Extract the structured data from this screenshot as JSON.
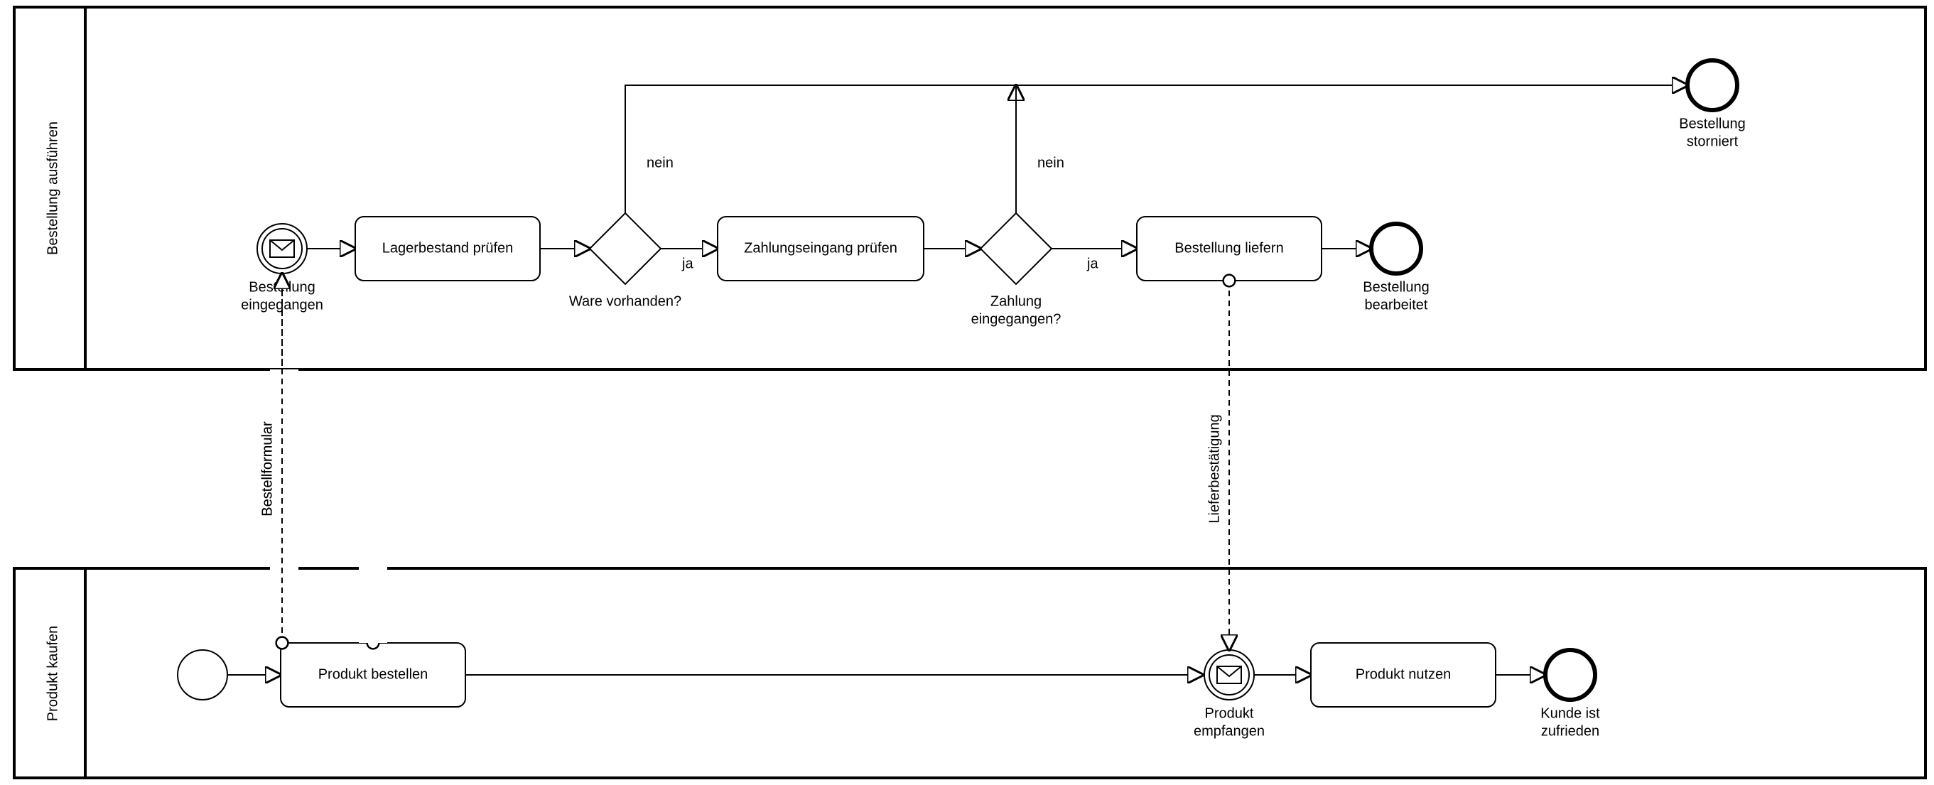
{
  "pools": {
    "top": {
      "name": "Bestellung ausführen"
    },
    "bottom": {
      "name": "Produkt kaufen"
    }
  },
  "top": {
    "start": {
      "label1": "Bestellung",
      "label2": "eingegangen"
    },
    "task_stock": "Lagerbestand prüfen",
    "gw_stock": {
      "label": "Ware vorhanden?",
      "yes": "ja",
      "no": "nein"
    },
    "task_payment": "Zahlungseingang prüfen",
    "gw_payment": {
      "label1": "Zahlung",
      "label2": "eingegangen?",
      "yes": "ja",
      "no": "nein"
    },
    "task_deliver": "Bestellung liefern",
    "end_cancel": {
      "label1": "Bestellung",
      "label2": "storniert"
    },
    "end_done": {
      "label1": "Bestellung",
      "label2": "bearbeitet"
    }
  },
  "bottom": {
    "task_order": "Produkt bestellen",
    "catch_product": {
      "label1": "Produkt",
      "label2": "empfangen"
    },
    "task_use": "Produkt nutzen",
    "end": {
      "label1": "Kunde ist",
      "label2": "zufrieden"
    }
  },
  "messages": {
    "order_form": "Bestellformular",
    "delivery_conf": "Lieferbestätigung"
  }
}
